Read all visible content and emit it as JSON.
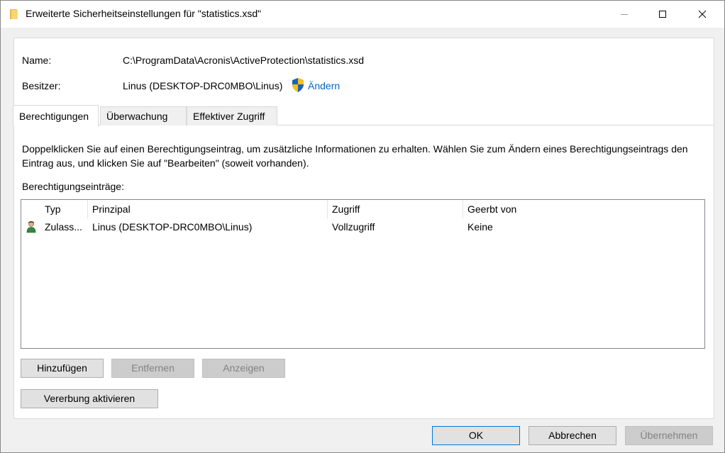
{
  "window": {
    "title": "Erweiterte Sicherheitseinstellungen für \"statistics.xsd\""
  },
  "header": {
    "name_label": "Name:",
    "name_value": "C:\\ProgramData\\Acronis\\ActiveProtection\\statistics.xsd",
    "owner_label": "Besitzer:",
    "owner_value": "Linus (DESKTOP-DRC0MBO\\Linus)",
    "change_link": "Ändern"
  },
  "tabs": [
    {
      "label": "Berechtigungen",
      "active": true
    },
    {
      "label": "Überwachung",
      "active": false
    },
    {
      "label": "Effektiver Zugriff",
      "active": false
    }
  ],
  "permissions": {
    "description": "Doppelklicken Sie auf einen Berechtigungseintrag, um zusätzliche Informationen zu erhalten. Wählen Sie zum Ändern eines Berechtigungseintrags den Eintrag aus, und klicken Sie auf \"Bearbeiten\" (soweit vorhanden).",
    "entries_label": "Berechtigungseinträge:",
    "columns": [
      "Typ",
      "Prinzipal",
      "Zugriff",
      "Geerbt von"
    ],
    "rows": [
      {
        "type": "Zulass...",
        "principal": "Linus (DESKTOP-DRC0MBO\\Linus)",
        "access": "Vollzugriff",
        "inherited_from": "Keine",
        "icon": "user-icon"
      }
    ]
  },
  "buttons": {
    "add": "Hinzufügen",
    "remove": "Entfernen",
    "view": "Anzeigen",
    "inherit": "Vererbung aktivieren",
    "ok": "OK",
    "cancel": "Abbrechen",
    "apply": "Übernehmen"
  },
  "colors": {
    "link": "#0066cc",
    "focus_border": "#0078d7",
    "disabled_text": "#838383"
  }
}
